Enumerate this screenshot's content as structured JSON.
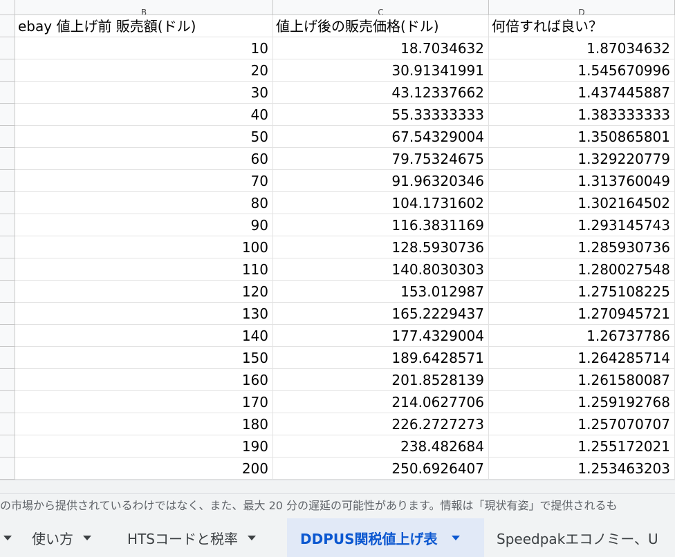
{
  "columns": {
    "b": "B",
    "c": "C",
    "d": "D"
  },
  "header_row": {
    "b": "ebay 値上げ前 販売額(ドル)",
    "c": "値上げ後の販売価格(ドル)",
    "d": "何倍すれば良い？"
  },
  "rows": [
    {
      "b": "10",
      "c": "18.7034632",
      "d": "1.87034632"
    },
    {
      "b": "20",
      "c": "30.91341991",
      "d": "1.545670996"
    },
    {
      "b": "30",
      "c": "43.12337662",
      "d": "1.437445887"
    },
    {
      "b": "40",
      "c": "55.33333333",
      "d": "1.383333333"
    },
    {
      "b": "50",
      "c": "67.54329004",
      "d": "1.350865801"
    },
    {
      "b": "60",
      "c": "79.75324675",
      "d": "1.329220779"
    },
    {
      "b": "70",
      "c": "91.96320346",
      "d": "1.313760049"
    },
    {
      "b": "80",
      "c": "104.1731602",
      "d": "1.302164502"
    },
    {
      "b": "90",
      "c": "116.3831169",
      "d": "1.293145743"
    },
    {
      "b": "100",
      "c": "128.5930736",
      "d": "1.285930736"
    },
    {
      "b": "110",
      "c": "140.8030303",
      "d": "1.280027548"
    },
    {
      "b": "120",
      "c": "153.012987",
      "d": "1.275108225"
    },
    {
      "b": "130",
      "c": "165.2229437",
      "d": "1.270945721"
    },
    {
      "b": "140",
      "c": "177.4329004",
      "d": "1.26737786"
    },
    {
      "b": "150",
      "c": "189.6428571",
      "d": "1.264285714"
    },
    {
      "b": "160",
      "c": "201.8528139",
      "d": "1.261580087"
    },
    {
      "b": "170",
      "c": "214.0627706",
      "d": "1.259192768"
    },
    {
      "b": "180",
      "c": "226.2727273",
      "d": "1.257070707"
    },
    {
      "b": "190",
      "c": "238.482684",
      "d": "1.255172021"
    },
    {
      "b": "200",
      "c": "250.6926407",
      "d": "1.253463203"
    }
  ],
  "notice": "の市場から提供されているわけではなく、また、最大 20 分の遅延の可能性があります。情報は「現状有姿」で提供されるも",
  "tabs": [
    {
      "label": "使い方",
      "active": false
    },
    {
      "label": "HTSコードと税率",
      "active": false
    },
    {
      "label": "DDPUS関税値上げ表",
      "active": true
    },
    {
      "label": "Speedpakエコノミー、U",
      "active": false
    }
  ],
  "colors": {
    "active_tab_bg": "#e1e9f7",
    "active_tab_text": "#0b57d0",
    "grid_line": "#e2e2e2"
  }
}
